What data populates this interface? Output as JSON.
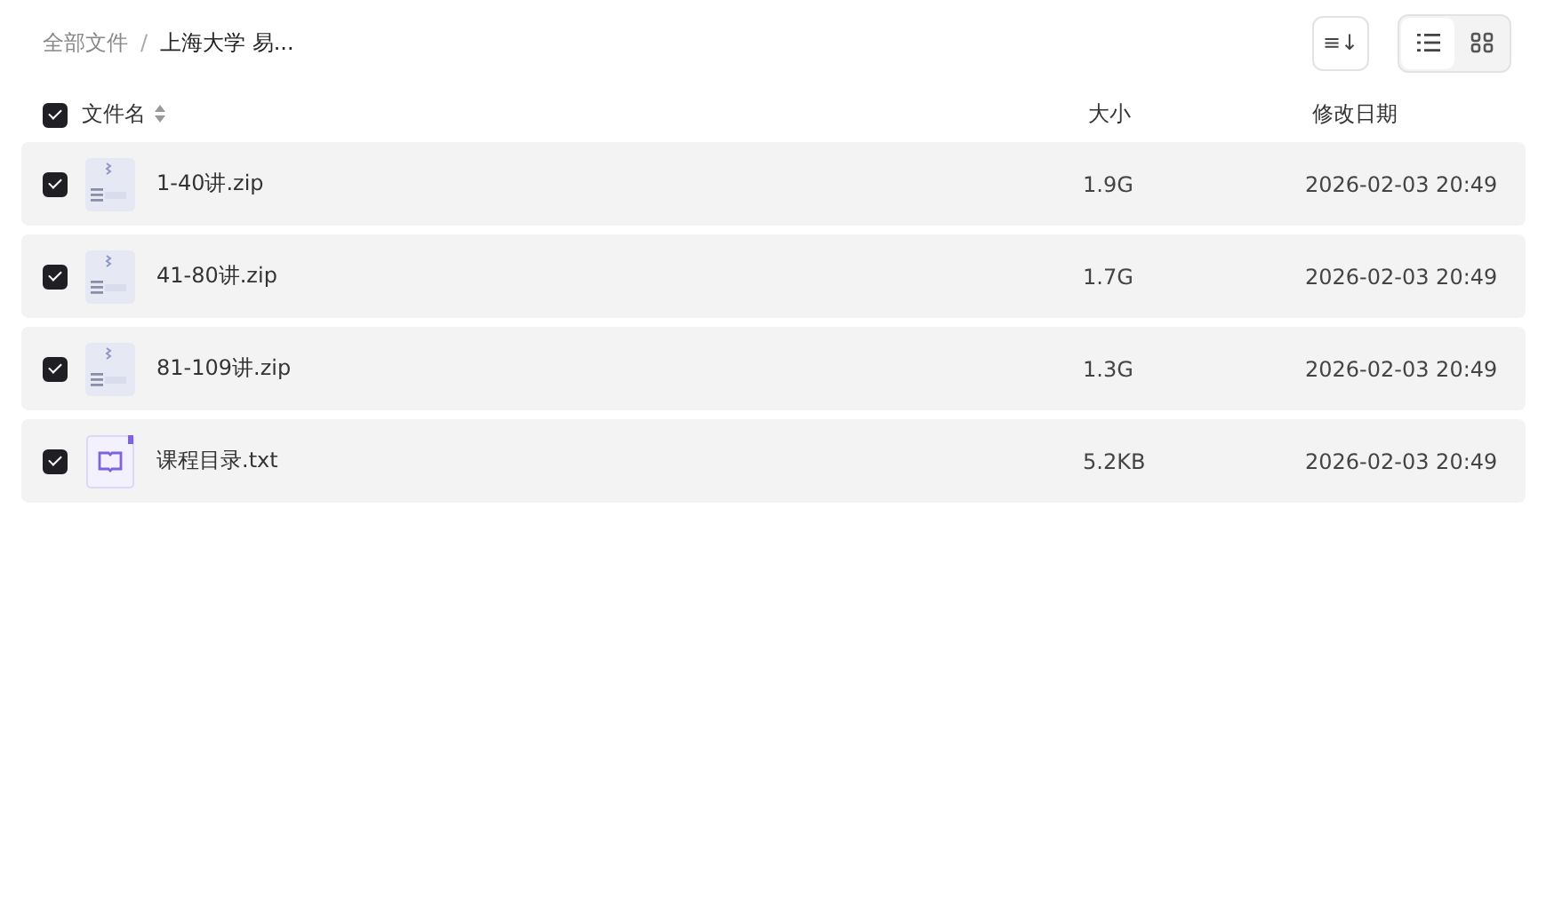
{
  "breadcrumb_separator": "/",
  "breadcrumb": [
    {
      "label": "全部文件",
      "current": false
    },
    {
      "label": "上海大学 易...",
      "current": true
    }
  ],
  "toolbar": {
    "sort_button": "≡↓",
    "view_modes": [
      {
        "kind": "list",
        "selected": true
      },
      {
        "kind": "grid",
        "selected": false
      }
    ]
  },
  "header": {
    "select_all": {
      "checked": true
    },
    "columns": [
      "文件名",
      "大小",
      "修改日期"
    ]
  },
  "rows": [
    {
      "checked": true,
      "kind": "zip",
      "name": "1-40讲.zip",
      "size": "1.9G",
      "date": "2026-02-03 20:49"
    },
    {
      "checked": true,
      "kind": "zip",
      "name": "41-80讲.zip",
      "size": "1.7G",
      "date": "2026-02-03 20:49"
    },
    {
      "checked": true,
      "kind": "zip",
      "name": "81-109讲.zip",
      "size": "1.3G",
      "date": "2026-02-03 20:49"
    },
    {
      "checked": true,
      "kind": "txt",
      "name": "课程目录.txt",
      "size": "5.2KB",
      "date": "2026-02-03 20:49"
    }
  ]
}
